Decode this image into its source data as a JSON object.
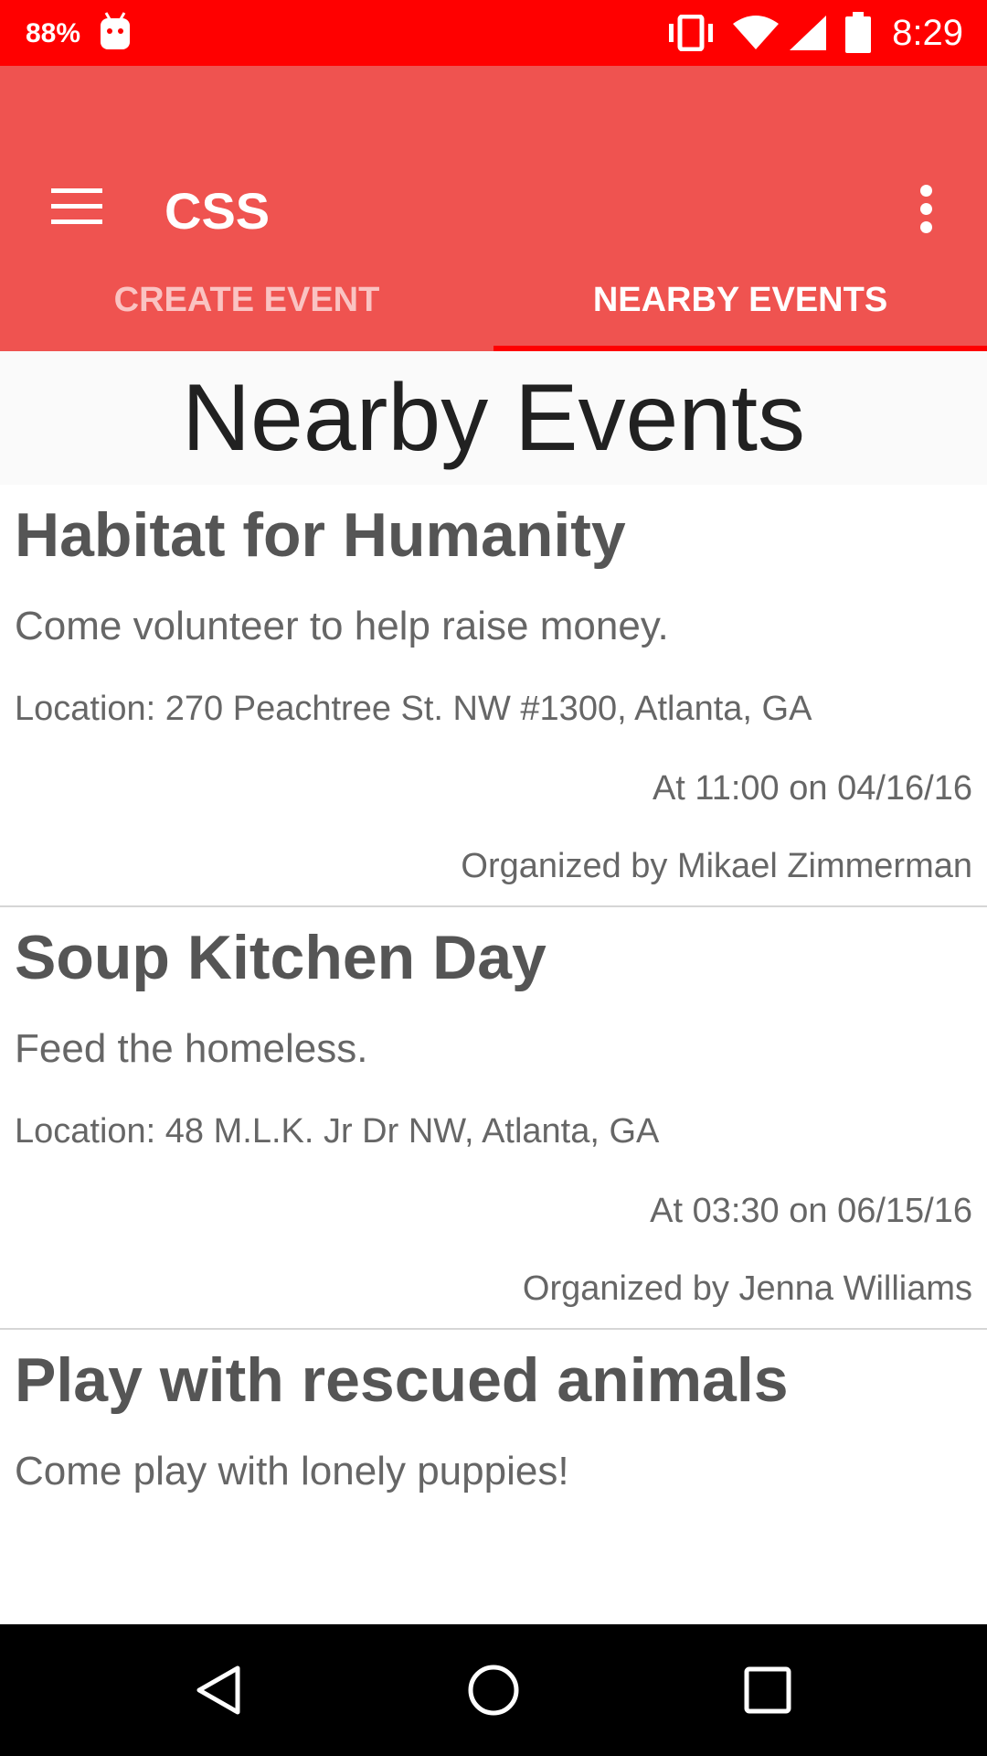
{
  "status_bar": {
    "battery_percent": "88%",
    "time": "8:29",
    "icons": [
      "android-debug-icon",
      "vibrate-icon",
      "wifi-icon",
      "signal-icon",
      "battery-icon"
    ]
  },
  "app_bar": {
    "title": "CSS",
    "menu_icon": "hamburger-menu-icon",
    "overflow_icon": "more-vert-icon"
  },
  "tabs": [
    {
      "label": "CREATE EVENT",
      "selected": false
    },
    {
      "label": "NEARBY EVENTS",
      "selected": true
    }
  ],
  "main": {
    "heading": "Nearby Events",
    "events": [
      {
        "title": "Habitat for Humanity",
        "description": "Come volunteer to help raise money.",
        "location": "Location: 270 Peachtree St. NW #1300, Atlanta, GA",
        "time": "At 11:00 on 04/16/16",
        "organizer": "Organized by Mikael Zimmerman"
      },
      {
        "title": "Soup Kitchen Day",
        "description": "Feed the homeless.",
        "location": "Location: 48 M.L.K. Jr Dr NW, Atlanta, GA",
        "time": "At 03:30 on 06/15/16",
        "organizer": "Organized by Jenna Williams"
      },
      {
        "title": "Play with rescued animals",
        "description": "Come play with lonely puppies!"
      }
    ]
  },
  "nav_bar": {
    "icons": [
      "back-icon",
      "home-icon",
      "recents-icon"
    ]
  },
  "colors": {
    "status_bar": "#ff0000",
    "app_bar": "#ef5350",
    "tab_indicator": "#ff0000",
    "heading_bg": "#fafafa"
  }
}
